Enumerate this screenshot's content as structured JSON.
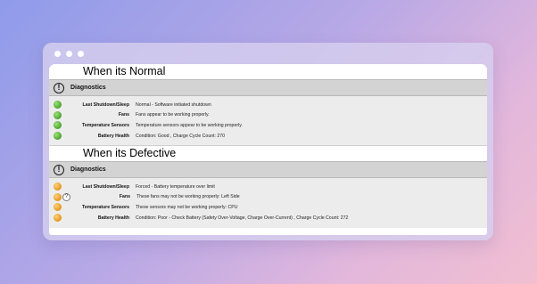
{
  "window": {
    "controls": [
      "dot",
      "dot",
      "dot"
    ]
  },
  "normal": {
    "heading": "When its Normal",
    "section_title": "Diagnostics",
    "rows": [
      {
        "label": "Last Shutdown/Sleep",
        "value": "Normal - Software initiated shutdown",
        "status": "green"
      },
      {
        "label": "Fans",
        "value": "Fans appear to be working properly.",
        "status": "green"
      },
      {
        "label": "Temperature Sensors",
        "value": "Temperature sensors appear to be working properly.",
        "status": "green"
      },
      {
        "label": "Battery Health",
        "value": "Condition: Good , Charge Cycle Count: 270",
        "status": "green"
      }
    ]
  },
  "defective": {
    "heading": "When its Defective",
    "section_title": "Diagnostics",
    "rows": [
      {
        "label": "Last Shutdown/Sleep",
        "value": "Forced - Battery temperature over limit",
        "status": "orange"
      },
      {
        "label": "Fans",
        "value": "These fans may not be working properly: Left Side",
        "status": "orange",
        "help": "?"
      },
      {
        "label": "Temperature Sensors",
        "value": "These sensors may not be working properly: CPU",
        "status": "orange"
      },
      {
        "label": "Battery Health",
        "value": "Condition: Poor - Check Battery (Safety Over-Voltage, Charge Over-Current) , Charge Cycle Count: 272",
        "status": "orange"
      }
    ]
  },
  "colors": {
    "ok": "#48a32b",
    "warning": "#e3951e",
    "section_bar": "#d3d3d3"
  },
  "icons": {
    "section": "exclamation-circle-icon",
    "ok_status": "green-dot-icon",
    "warning_status": "orange-dot-icon",
    "help": "question-mark-icon"
  }
}
